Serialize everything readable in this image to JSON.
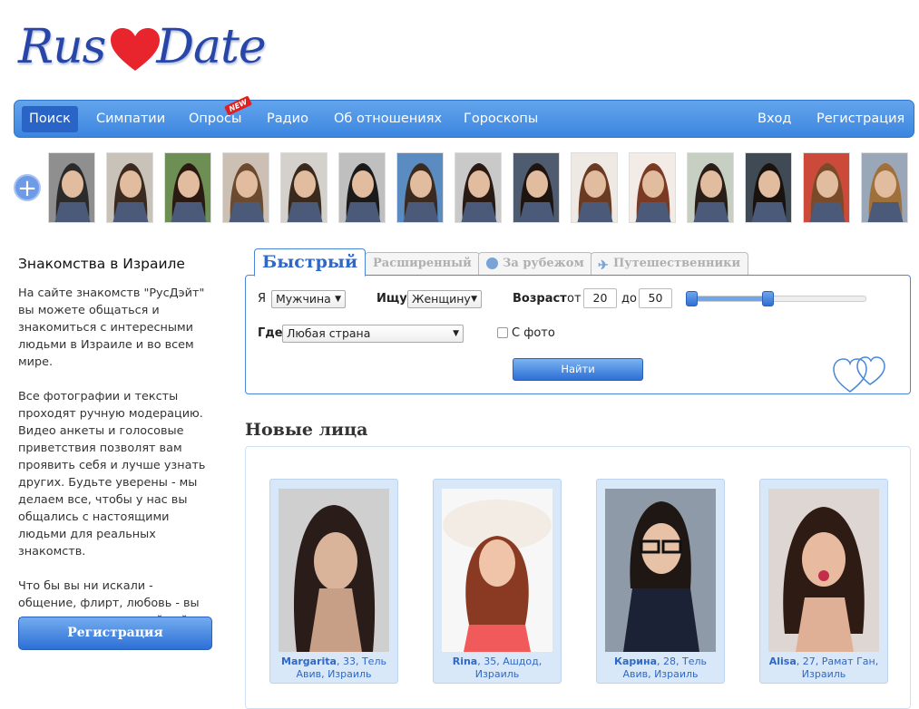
{
  "logo": {
    "text_left": "Rus",
    "text_right": "Date"
  },
  "nav": {
    "items": [
      {
        "label": "Поиск",
        "active": true
      },
      {
        "label": "Симпатии"
      },
      {
        "label": "Опросы"
      },
      {
        "label": "Радио"
      },
      {
        "label": "Об отношениях"
      },
      {
        "label": "Гороскопы"
      }
    ],
    "new_badge": "NEW",
    "right": [
      {
        "label": "Вход"
      },
      {
        "label": "Регистрация"
      }
    ]
  },
  "avatars": {
    "add_label": "+",
    "count": 15
  },
  "sidebar": {
    "title": "Знакомства в Израиле",
    "p1": "На сайте знакомств \"РусДэйт\" вы можете общаться и знакомиться с интересными людьми в Израиле и во всем мире.",
    "p2": "Все фотографии и тексты проходят ручную модерацию. Видео анкеты и голосовые приветствия позволят вам проявить себя и лучше узнать других. Будьте уверены - мы делаем все, чтобы у нас вы общались с настоящими людьми для реальных знакомств.",
    "p3": "Что бы вы ни искали - общение, флирт, любовь - вы пришли на правильный сайт. Удачи!",
    "register_button": "Регистрация"
  },
  "tabs": [
    {
      "label": "Быстрый",
      "active": true
    },
    {
      "label": "Расширенный"
    },
    {
      "label": "За рубежом"
    },
    {
      "label": "Путешественники"
    }
  ],
  "search": {
    "i_label": "Я",
    "i_value": "Мужчина",
    "seek_label": "Ищу",
    "seek_value": "Женщину",
    "age_label": "Возраст",
    "from_label": "от",
    "age_from": "20",
    "to_label": "до",
    "age_to": "50",
    "where_label": "Где",
    "where_value": "Любая страна",
    "photo_label": "С фото",
    "find_button": "Найти"
  },
  "new_faces": {
    "title": "Новые лица",
    "cards": [
      {
        "name": "Margarita",
        "details": ", 33, Тель Авив, Израиль"
      },
      {
        "name": "Rina",
        "details": ", 35, Ашдод, Израиль"
      },
      {
        "name": "Карина",
        "details": ", 28, Тель Авив, Израиль"
      },
      {
        "name": "Alisa",
        "details": ", 27, Рамат Ган, Израиль"
      }
    ]
  },
  "colors": {
    "accent": "#3c86e0",
    "link": "#2f68c6",
    "card_bg": "#d9e8f9",
    "heart": "#e8242c"
  }
}
